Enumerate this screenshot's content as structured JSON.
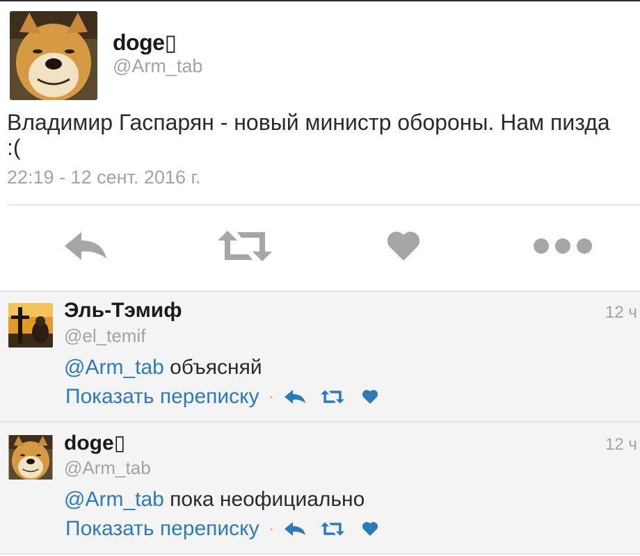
{
  "tweet": {
    "author_name": "doge▯",
    "author_handle": "@Arm_tab",
    "text": "Владимир Гаспарян - новый министр обороны. Нам пизда :(",
    "timestamp": "22:19 - 12 сент. 2016 г.",
    "actions": [
      "reply-icon",
      "retweet-icon",
      "like-icon",
      "more-icon"
    ]
  },
  "replies": [
    {
      "author_name": "Эль-Тэмиф",
      "author_handle": "@el_temif",
      "time": "12 ч",
      "mention": "@Arm_tab",
      "text": " объясняй",
      "show_conversation": "Показать переписку",
      "separator": "·"
    },
    {
      "author_name": "doge▯",
      "author_handle": "@Arm_tab",
      "time": "12 ч",
      "mention": "@Arm_tab",
      "text": " пока неофициально",
      "show_conversation": "Показать переписку",
      "separator": "·"
    }
  ],
  "colors": {
    "link": "#2b7bb9",
    "muted": "#a3a3a3",
    "action_icon": "#a6a6a6",
    "reply_background": "#f4f4f4"
  }
}
